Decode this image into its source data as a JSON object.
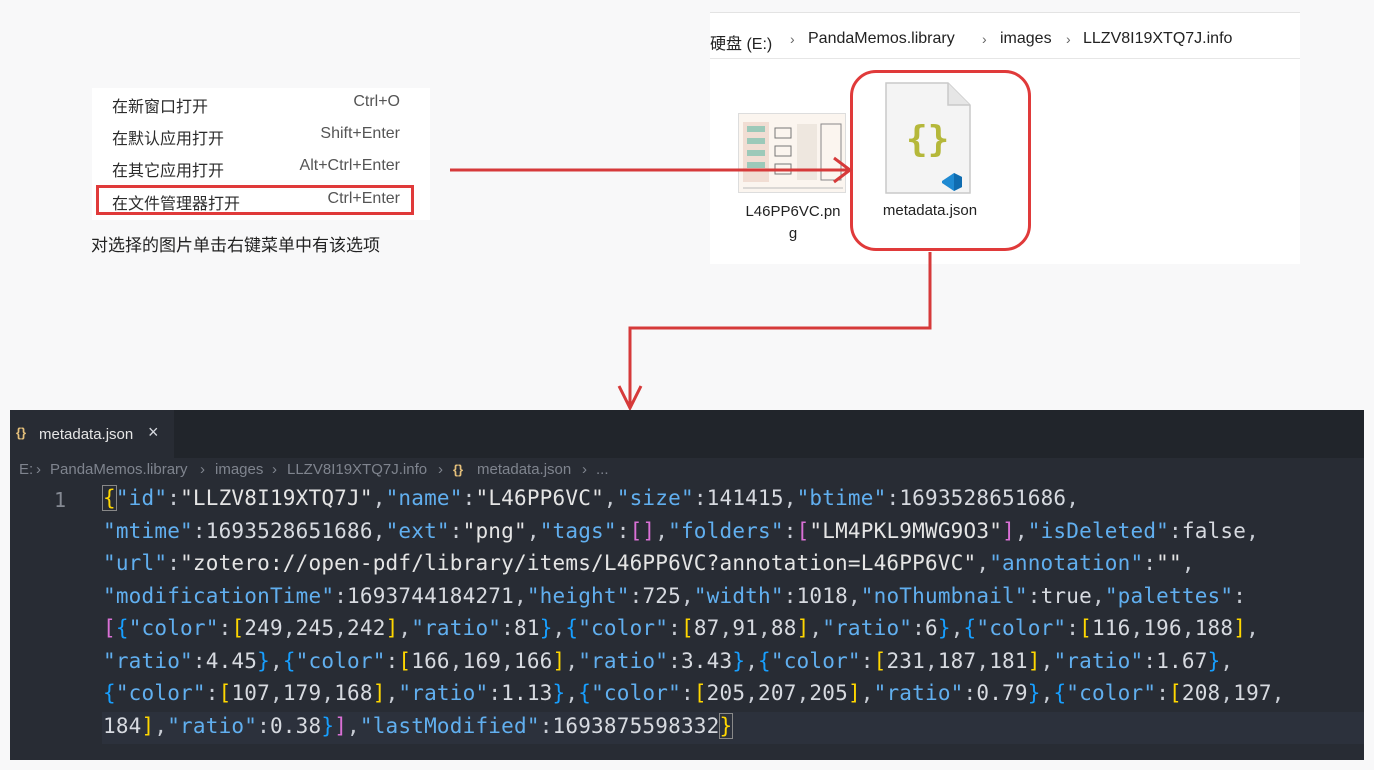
{
  "context_menu": {
    "items": [
      {
        "label": "在新窗口打开",
        "shortcut": "Ctrl+O"
      },
      {
        "label": "在默认应用打开",
        "shortcut": "Shift+Enter"
      },
      {
        "label": "在其它应用打开",
        "shortcut": "Alt+Ctrl+Enter"
      },
      {
        "label": "在文件管理器打开",
        "shortcut": "Ctrl+Enter"
      }
    ],
    "highlighted_index": 3,
    "caption": "对选择的图片单击右键菜单中有该选项"
  },
  "explorer": {
    "breadcrumb": [
      "硬盘 (E:)",
      "PandaMemos.library",
      "images",
      "LLZV8I19XTQ7J.info"
    ],
    "files": [
      {
        "name_line1": "L46PP6VC.pn",
        "name_line2": "g",
        "icon": "image-thumbnail-icon"
      },
      {
        "name": "metadata.json",
        "icon": "json-file-icon",
        "highlighted": true
      }
    ]
  },
  "editor": {
    "tab": {
      "icon": "{}",
      "label": "metadata.json",
      "close": "×"
    },
    "breadcrumb": [
      "E:",
      "PandaMemos.library",
      "images",
      "LLZV8I19XTQ7J.info",
      "metadata.json",
      "..."
    ],
    "line_number": "1",
    "colors": {
      "key": "#61afef",
      "bracket1": "#ffd700",
      "bracket2": "#da70d6",
      "bracket3": "#179fff",
      "background": "#282c34"
    },
    "json": {
      "id": "LLZV8I19XTQ7J",
      "name": "L46PP6VC",
      "size": "141415",
      "btime": "1693528651686",
      "mtime": "1693528651686",
      "ext": "png",
      "folders_0": "LM4PKL9MWG9O3",
      "isDeleted": "false",
      "url": "zotero://open-pdf/library/items/L46PP6VC?annotation=L46PP6VC",
      "annotation": "",
      "modificationTime": "1693744184271",
      "height": "725",
      "width": "1018",
      "noThumbnail": "true",
      "palettes": [
        {
          "color": [
            "249",
            "245",
            "242"
          ],
          "ratio": "81"
        },
        {
          "color": [
            "87",
            "91",
            "88"
          ],
          "ratio": "6"
        },
        {
          "color": [
            "116",
            "196",
            "188"
          ],
          "ratio": "4.45"
        },
        {
          "color": [
            "166",
            "169",
            "166"
          ],
          "ratio": "3.43"
        },
        {
          "color": [
            "231",
            "187",
            "181"
          ],
          "ratio": "1.67"
        },
        {
          "color": [
            "107",
            "179",
            "168"
          ],
          "ratio": "1.13"
        },
        {
          "color": [
            "205",
            "207",
            "205"
          ],
          "ratio": "0.79"
        },
        {
          "color": [
            "208",
            "197",
            "184"
          ],
          "ratio": "0.38"
        }
      ],
      "lastModified": "1693875598332"
    }
  }
}
